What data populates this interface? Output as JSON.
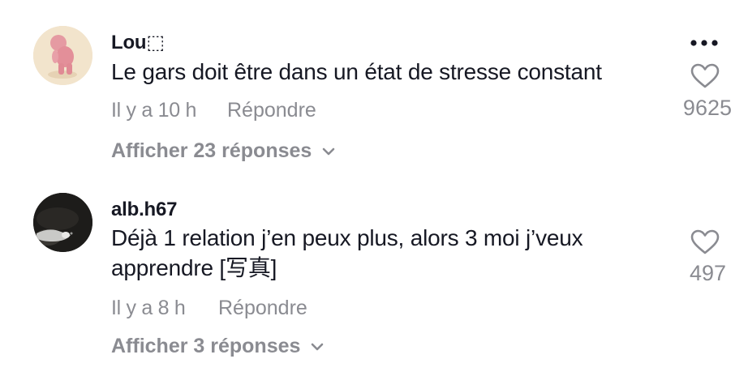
{
  "comments": [
    {
      "username": "Lou⬚",
      "text": "Le gars doit être dans un état de stresse constant",
      "time": "Il y a 10 h",
      "reply_label": "Répondre",
      "view_replies": "Afficher 23 réponses",
      "likes": "9625",
      "avatar_icon": "pink-figure-avatar"
    },
    {
      "username": "alb.h67",
      "text": "Déjà 1 relation j’en peux plus, alors 3 moi j’veux apprendre [写真]",
      "time": "Il y a 8 h",
      "reply_label": "Répondre",
      "view_replies": "Afficher 3 réponses",
      "likes": "497",
      "avatar_icon": "dark-photo-avatar"
    }
  ],
  "more_icon": "more-horizontal-icon",
  "like_icon": "heart-outline-icon",
  "colors": {
    "primary_text": "#161823",
    "secondary_text": "#8a8b91",
    "background": "#ffffff"
  }
}
